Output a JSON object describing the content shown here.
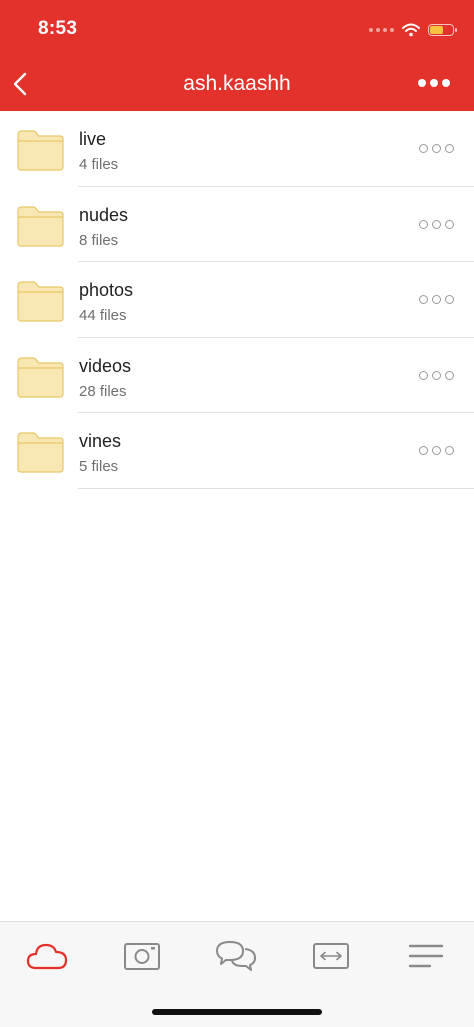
{
  "status_bar": {
    "time": "8:53"
  },
  "header": {
    "title": "ash.kaashh"
  },
  "folders": [
    {
      "name": "live",
      "count": "4 files"
    },
    {
      "name": "nudes",
      "count": "8 files"
    },
    {
      "name": "photos",
      "count": "44 files"
    },
    {
      "name": "videos",
      "count": "28 files"
    },
    {
      "name": "vines",
      "count": "5 files"
    }
  ],
  "tabbar": {
    "items": [
      "cloud-icon",
      "camera-icon",
      "chat-icon",
      "transfer-icon",
      "menu-icon"
    ],
    "active": "cloud-icon"
  },
  "colors": {
    "accent": "#e2322b",
    "folder_fill": "#f8e7b2",
    "folder_stroke": "#e8c766",
    "tab_icon": "#8a8a8a"
  }
}
